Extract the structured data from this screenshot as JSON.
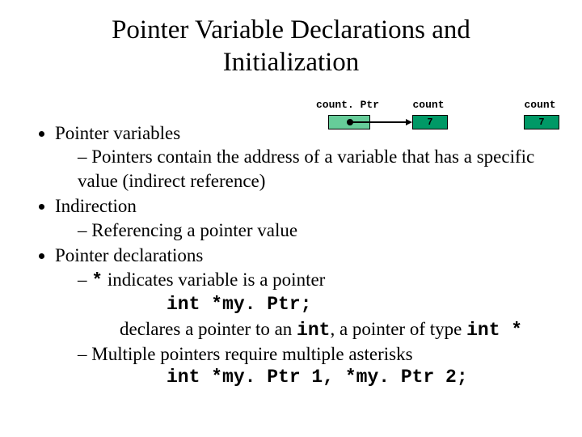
{
  "title_l1": "Pointer Variable Declarations and",
  "title_l2": "Initialization",
  "diagram": {
    "label_ptr": "count. Ptr",
    "label_count1": "count",
    "label_count2": "count",
    "val1": "7",
    "val2": "7"
  },
  "bullets": {
    "b1": "Pointer variables",
    "b1s1": "Pointers contain the address of a variable that has a specific value (indirect reference)",
    "b2": "Indirection",
    "b2s1": "Referencing a pointer value",
    "b3": "Pointer declarations",
    "b3s1_star": "*",
    "b3s1_rest": " indicates variable is a pointer",
    "b3s1_code": "int *my. Ptr;",
    "b3s1_decl_pre": "declares a pointer to an ",
    "b3s1_decl_int": "int",
    "b3s1_decl_mid": ", a pointer of type ",
    "b3s1_decl_type": "int *",
    "b3s2": "Multiple pointers require multiple asterisks",
    "b3s2_code": "int *my. Ptr 1, *my. Ptr 2;"
  }
}
